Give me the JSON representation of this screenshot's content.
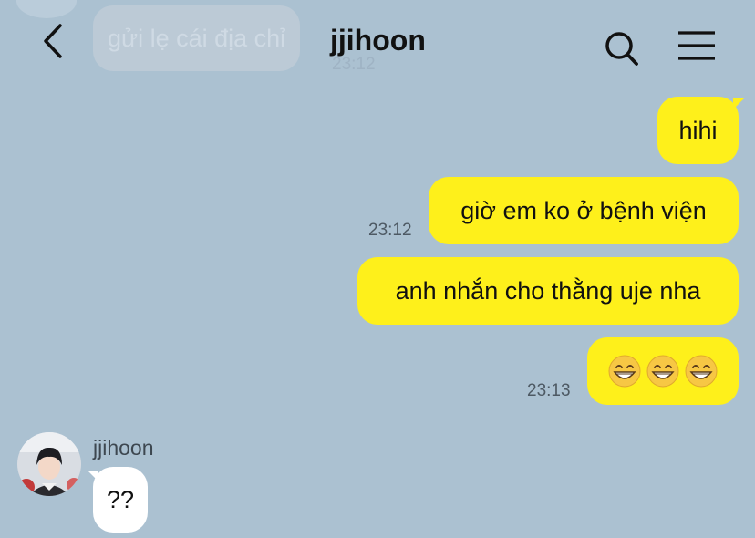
{
  "header": {
    "title": "jjihoon",
    "ghost_message": "gửi lẹ cái địa chỉ",
    "ghost_time": "23:12"
  },
  "messages": {
    "out1": "hihi",
    "out2": "giờ em ko ở bệnh viện",
    "out2_time": "23:12",
    "out3": "anh nhắn cho thằng uje nha",
    "out4_emojis": [
      "grinning-face-with-smiling-eyes",
      "grinning-face-with-smiling-eyes",
      "grinning-face-with-smiling-eyes"
    ],
    "out4_time": "23:13",
    "in_sender": "jjihoon",
    "in1": "??"
  },
  "icons": {
    "back": "chevron-left-icon",
    "search": "search-icon",
    "menu": "hamburger-menu-icon"
  },
  "colors": {
    "background": "#abc1d1",
    "outgoing_bubble": "#fef01b",
    "incoming_bubble": "#ffffff"
  }
}
